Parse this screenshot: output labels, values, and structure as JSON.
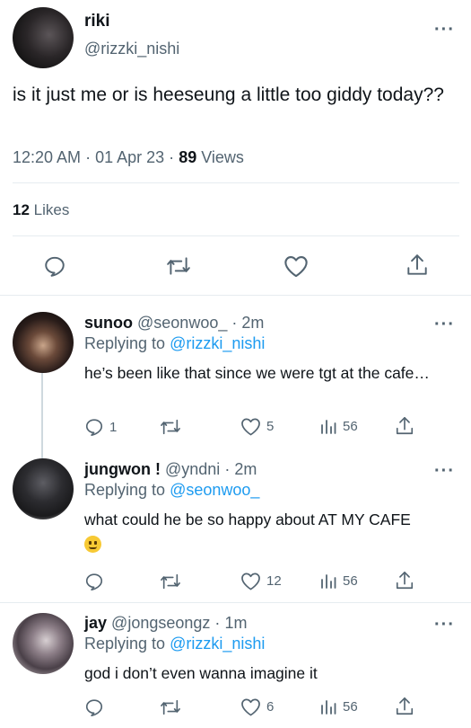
{
  "main_tweet": {
    "display_name": "riki",
    "handle": "@rizzki_nishi",
    "text": "is it just me or is heeseung a little too giddy today??",
    "time": "12:20 AM",
    "date": "01 Apr 23",
    "separator": "·",
    "views_count": "89",
    "views_label": "Views",
    "likes_count": "12",
    "likes_label": "Likes"
  },
  "replies": [
    {
      "display_name": "sunoo",
      "handle": "@seonwoo_",
      "time": "2m",
      "replying_label": "Replying to",
      "replying_to": "@rizzki_nishi",
      "text": "he’s been like that since we were tgt at the cafe…",
      "replies": "1",
      "retweets": "",
      "likes": "5",
      "views": "56"
    },
    {
      "display_name": "jungwon !",
      "handle": "@yndni",
      "time": "2m",
      "replying_label": "Replying to",
      "replying_to": "@seonwoo_",
      "text": "what could he be so happy about AT MY CAFE",
      "emoji": "grinning-face-emoji",
      "replies": "",
      "retweets": "",
      "likes": "12",
      "views": "56"
    },
    {
      "display_name": "jay",
      "handle": "@jongseongz",
      "time": "1m",
      "replying_label": "Replying to",
      "replying_to": "@rizzki_nishi",
      "text": "god i don’t even wanna imagine it",
      "replies": "",
      "retweets": "",
      "likes": "6",
      "views": "56"
    }
  ],
  "icons": [
    "reply-icon",
    "retweet-icon",
    "like-icon",
    "share-icon",
    "views-icon",
    "more-icon"
  ],
  "colors": {
    "text": "#0f1419",
    "secondary": "#536471",
    "link": "#1d9bf0",
    "divider": "#e6ecf0"
  }
}
